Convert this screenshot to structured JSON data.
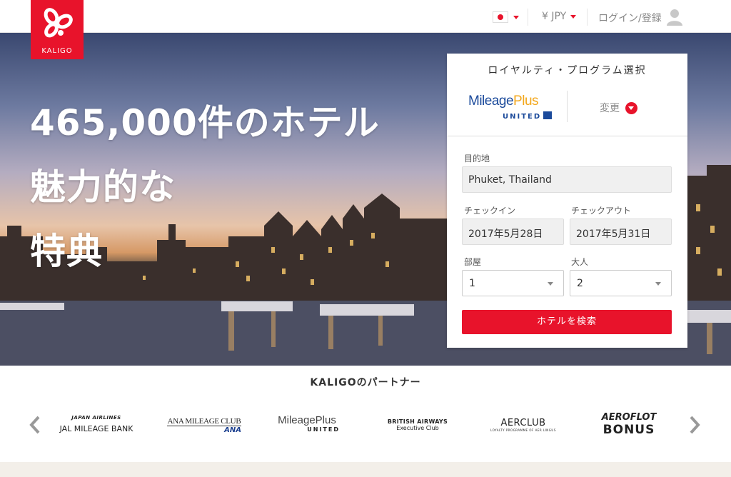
{
  "brand": {
    "name": "KALIGO",
    "color": "#e8132b"
  },
  "header": {
    "language_flag": "jp-flag-icon",
    "currency": "¥ JPY",
    "login": "ログイン/登録"
  },
  "hero": {
    "lines": [
      "465,000件のホテル",
      "魅力的な",
      "特典"
    ]
  },
  "search": {
    "title": "ロイヤルティ・プログラム選択",
    "program": {
      "name_part1": "Mileage",
      "name_part2": "Plus",
      "sub": "UNITED"
    },
    "change": "変更",
    "destination_label": "目的地",
    "destination_value": "Phuket, Thailand",
    "checkin_label": "チェックイン",
    "checkin_value": "2017年5月28日",
    "checkout_label": "チェックアウト",
    "checkout_value": "2017年5月31日",
    "rooms_label": "部屋",
    "rooms_value": "1",
    "adults_label": "大人",
    "adults_value": "2",
    "submit": "ホテルを検索"
  },
  "partners": {
    "title": "KALIGOのパートナー",
    "items": [
      {
        "top": "JAPAN AIRLINES",
        "bottom": "JAL MILEAGE BANK"
      },
      {
        "top": "ANA MILEAGE CLUB",
        "bottom": "ANA"
      },
      {
        "top": "MileagePlus",
        "bottom": "UNITED"
      },
      {
        "top": "BRITISH AIRWAYS",
        "bottom": "Executive Club"
      },
      {
        "top": "AERCLUB",
        "bottom": "LOYALTY PROGRAMME OF AER LINGUS"
      },
      {
        "top": "AEROFLOT",
        "bottom": "BONUS"
      }
    ]
  }
}
